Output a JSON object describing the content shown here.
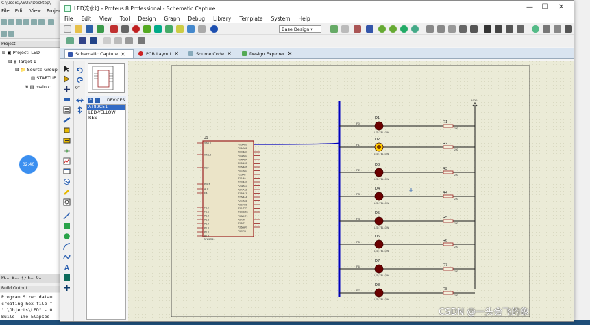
{
  "background_app": {
    "title": "C:\\Users\\ASUS\\Desktop\\",
    "menu": [
      "File",
      "Edit",
      "View",
      "Project"
    ],
    "project_panel_title": "Project",
    "tree": [
      "Project: LED",
      "Target 1",
      "Source Group",
      "STARTUP",
      "main.c"
    ],
    "clock": "02:40",
    "panel_tabs": [
      "Pr...",
      "B...",
      "{} F...",
      "0..."
    ],
    "build_header": "Build Output",
    "build_lines": [
      "Program Size: data=",
      "creating hex file f",
      "\".\\Objects\\LED\" - 0",
      "Build Time Elapsed:"
    ]
  },
  "window": {
    "title": "LED流水灯 - Proteus 8 Professional - Schematic Capture",
    "controls": {
      "minimize": "—",
      "maximize": "☐",
      "close": "✕"
    }
  },
  "menu": [
    "File",
    "Edit",
    "View",
    "Tool",
    "Design",
    "Graph",
    "Debug",
    "Library",
    "Template",
    "System",
    "Help"
  ],
  "toolbar": {
    "design_select": "Base Design"
  },
  "tabs": [
    {
      "label": "Schematic Capture",
      "close": "✕"
    },
    {
      "label": "PCB Layout",
      "close": "✕"
    },
    {
      "label": "Source Code",
      "close": "✕"
    },
    {
      "label": "Design Explorer",
      "close": "✕"
    }
  ],
  "rotation_value": "0°",
  "devices": {
    "header_p": "P",
    "header_l": "L",
    "header_label": "DEVICES",
    "items": [
      "AT89C51",
      "LED-YELLOW",
      "RES"
    ],
    "selected_index": 0
  },
  "schematic": {
    "mcu_ref": "U1",
    "mcu_name": "AT89C51",
    "power_label": "VDD",
    "led_type": "LED-YELLOW",
    "leds": [
      "D1",
      "D2",
      "D3",
      "D4",
      "D5",
      "D6",
      "D7",
      "D8"
    ],
    "resistors": [
      "R1",
      "R2",
      "R3",
      "R4",
      "R5",
      "R6",
      "R7",
      "R8"
    ],
    "resistor_value": "220",
    "net_labels": [
      "P0",
      "P1",
      "P2",
      "P3",
      "P4",
      "P5",
      "P6",
      "P7"
    ],
    "mcu_left_pins": [
      "XTAL1",
      "XTAL2",
      "RST",
      "PSEN",
      "ALE",
      "EA",
      "P1.0",
      "P1.1",
      "P1.2",
      "P1.3",
      "P1.4",
      "P1.5",
      "P1.6",
      "P1.7"
    ],
    "mcu_right_pins": [
      "P0.0/AD0",
      "P0.1/AD1",
      "P0.2/AD2",
      "P0.3/AD3",
      "P0.4/AD4",
      "P0.5/AD5",
      "P0.6/AD6",
      "P0.7/AD7",
      "P2.0/A8",
      "P2.1/A9",
      "P2.2/A10",
      "P2.3/A11",
      "P2.4/A12",
      "P2.5/A13",
      "P2.6/A14",
      "P2.7/A15",
      "P3.0/RXD",
      "P3.1/TXD",
      "P3.2/INT0",
      "P3.3/INT1",
      "P3.4/T0",
      "P3.5/T1",
      "P3.6/WR",
      "P3.7/RD"
    ],
    "lit_led_index": 1
  },
  "colors": {
    "sheet_bg": "#ebebd7",
    "wire": "#1a1a1a",
    "bus": "#0000c0",
    "component": "#9b2020",
    "led": "#6b0000",
    "led_lit": "#ffcc00",
    "selection": "#316ac5"
  },
  "watermark": "CSDN @一头会飞的象"
}
